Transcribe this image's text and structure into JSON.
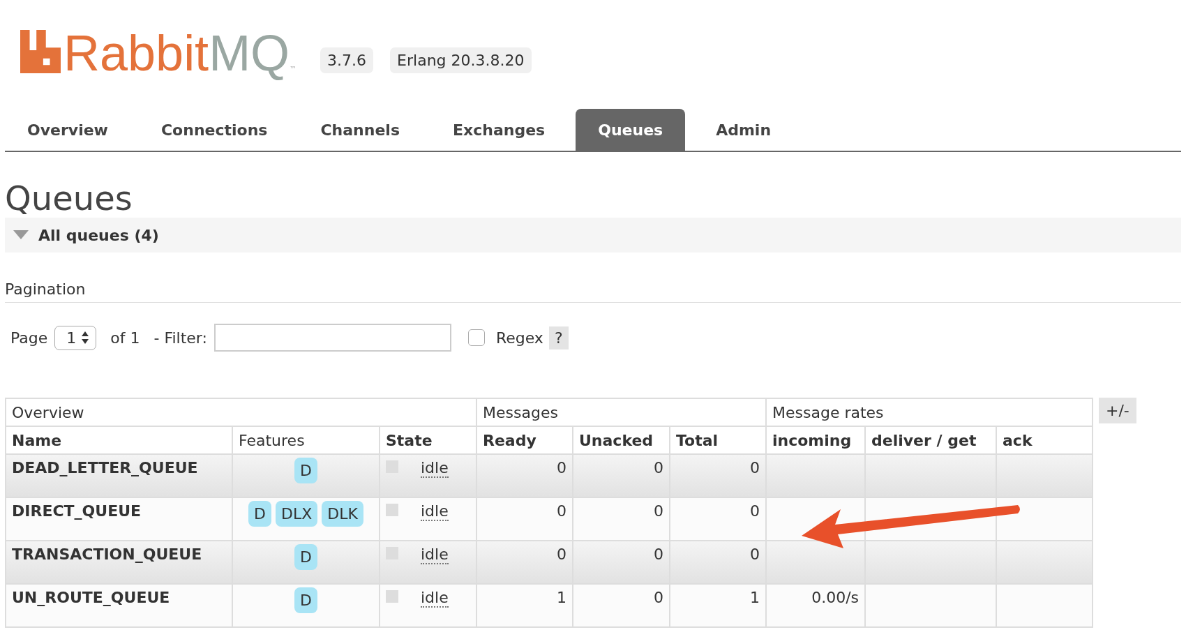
{
  "logo": {
    "parts": [
      "Rabbit",
      "MQ"
    ],
    "trademark": "™"
  },
  "versions": [
    "3.7.6",
    "Erlang 20.3.8.20"
  ],
  "tabs": [
    {
      "label": "Overview",
      "selected": false
    },
    {
      "label": "Connections",
      "selected": false
    },
    {
      "label": "Channels",
      "selected": false
    },
    {
      "label": "Exchanges",
      "selected": false
    },
    {
      "label": "Queues",
      "selected": true
    },
    {
      "label": "Admin",
      "selected": false
    }
  ],
  "heading": "Queues",
  "section": {
    "title": "All queues (4)",
    "expanded": true
  },
  "pagination": {
    "title": "Pagination",
    "page_label": "Page",
    "page_value": "1",
    "of_label": "of 1",
    "filter_label": "- Filter:",
    "regex": {
      "label": "Regex",
      "checked": false
    },
    "help": "?"
  },
  "table": {
    "groups": [
      {
        "label": "Overview"
      },
      {
        "label": "Messages"
      },
      {
        "label": "Message rates"
      }
    ],
    "columns": [
      {
        "label": "Name",
        "bold": true
      },
      {
        "label": "Features",
        "bold": false
      },
      {
        "label": "State",
        "bold": true
      },
      {
        "label": "Ready",
        "bold": true
      },
      {
        "label": "Unacked",
        "bold": true
      },
      {
        "label": "Total",
        "bold": true
      },
      {
        "label": "incoming",
        "bold": true
      },
      {
        "label": "deliver / get",
        "bold": true
      },
      {
        "label": "ack",
        "bold": true
      }
    ],
    "rows": [
      {
        "name": "DEAD_LETTER_QUEUE",
        "features": [
          "D"
        ],
        "state": "idle",
        "ready": "0",
        "unacked": "0",
        "total": "0"
      },
      {
        "name": "DIRECT_QUEUE",
        "features": [
          "D",
          "DLX",
          "DLK"
        ],
        "state": "idle",
        "ready": "0",
        "unacked": "0",
        "total": "0"
      },
      {
        "name": "TRANSACTION_QUEUE",
        "features": [
          "D"
        ],
        "state": "idle",
        "ready": "0",
        "unacked": "0",
        "total": "0"
      },
      {
        "name": "UN_ROUTE_QUEUE",
        "features": [
          "D"
        ],
        "state": "idle",
        "ready": "1",
        "unacked": "0",
        "total": "1",
        "incoming": "0.00/s"
      }
    ],
    "toggle": "+/-"
  }
}
